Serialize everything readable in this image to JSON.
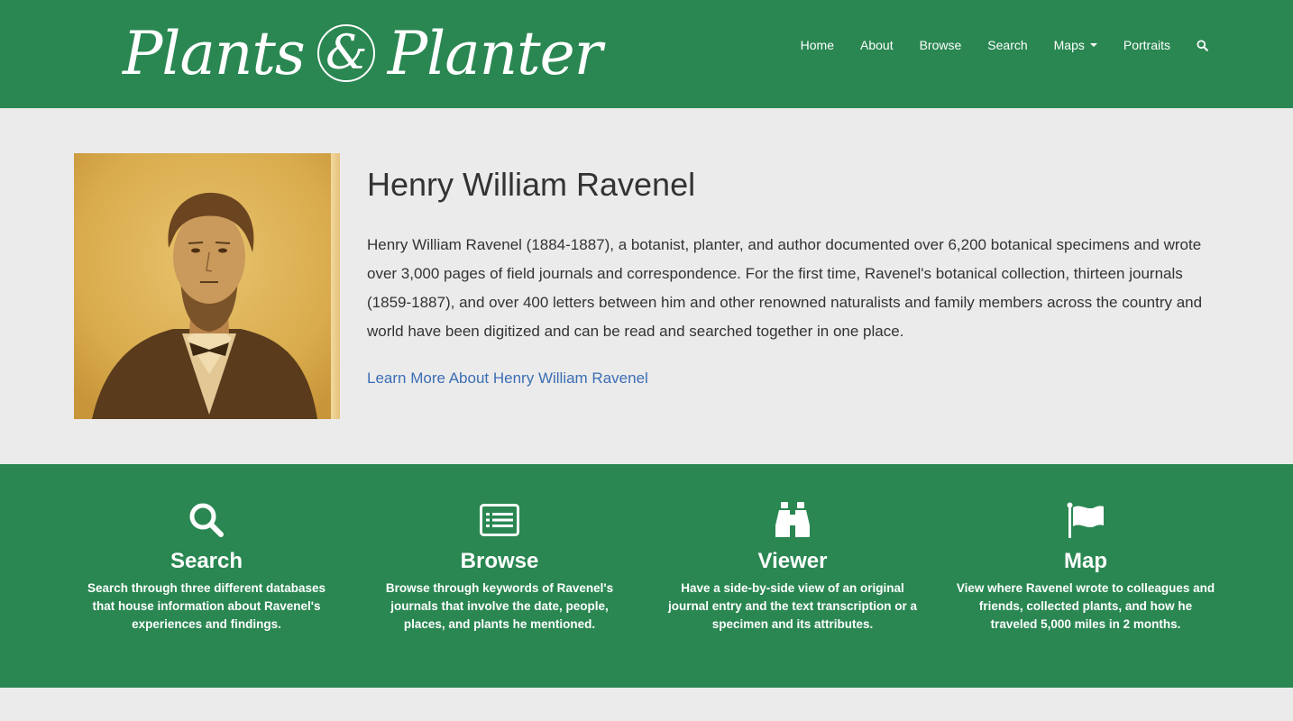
{
  "header": {
    "logo_part1": "Plants",
    "logo_amp": "&",
    "logo_part2": "Planter",
    "nav": [
      {
        "label": "Home"
      },
      {
        "label": "About"
      },
      {
        "label": "Browse"
      },
      {
        "label": "Search"
      },
      {
        "label": "Maps"
      },
      {
        "label": "Portraits"
      }
    ],
    "search_icon": "search-icon"
  },
  "hero": {
    "title": "Henry William Ravenel",
    "description": "Henry William Ravenel (1884-1887), a botanist, planter, and author documented over 6,200 botanical specimens and wrote over 3,000 pages of field journals and correspondence. For the first time, Ravenel's botanical collection, thirteen journals (1859-1887), and over 400 letters between him and other renowned naturalists and family members across the country and world have been digitized and can be read and searched together in one place.",
    "link_label": "Learn More About Henry William Ravenel"
  },
  "features": [
    {
      "icon": "search-icon",
      "title": "Search",
      "text": "Search through three different databases that house information about Ravenel's experiences and findings."
    },
    {
      "icon": "list-icon",
      "title": "Browse",
      "text": "Browse through keywords of Ravenel's journals that involve the date, people, places, and plants he mentioned."
    },
    {
      "icon": "binoculars-icon",
      "title": "Viewer",
      "text": "Have a side-by-side view of an original journal entry and the text transcription or a specimen and its attributes."
    },
    {
      "icon": "flag-icon",
      "title": "Map",
      "text": "View where Ravenel wrote to colleagues and friends, collected plants, and how he traveled 5,000 miles in 2 months."
    }
  ],
  "colors": {
    "brand_green": "#2a8752",
    "background": "#ebebeb",
    "link_blue": "#3c6eb4"
  }
}
